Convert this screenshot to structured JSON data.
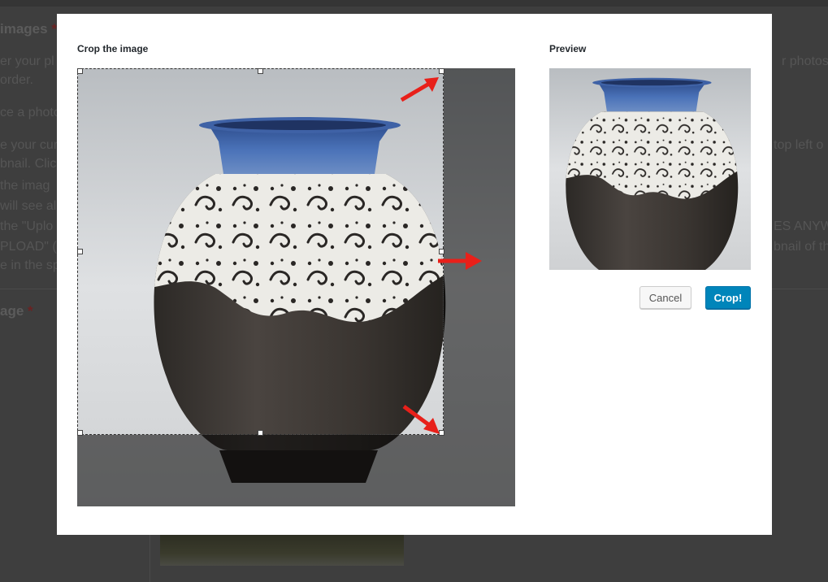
{
  "background": {
    "headings": [
      "images",
      "age"
    ],
    "lines": [
      "er your pl",
      "order.",
      "ce a photo",
      "e your cur",
      "bnail. Clic",
      "the imag",
      "will see all",
      "the \"Uplo",
      "PLOAD\" (",
      "e in the sp",
      "r photos",
      "top left o",
      "ES ANYW",
      "bnail of th"
    ]
  },
  "modal": {
    "crop_label": "Crop the image",
    "preview_label": "Preview",
    "cancel_label": "Cancel",
    "crop_button_label": "Crop!"
  },
  "colors": {
    "accent": "#0085ba",
    "arrow": "#e8201a",
    "vase_glaze": "#3a5ea8",
    "vase_clay": "#3b3632"
  }
}
